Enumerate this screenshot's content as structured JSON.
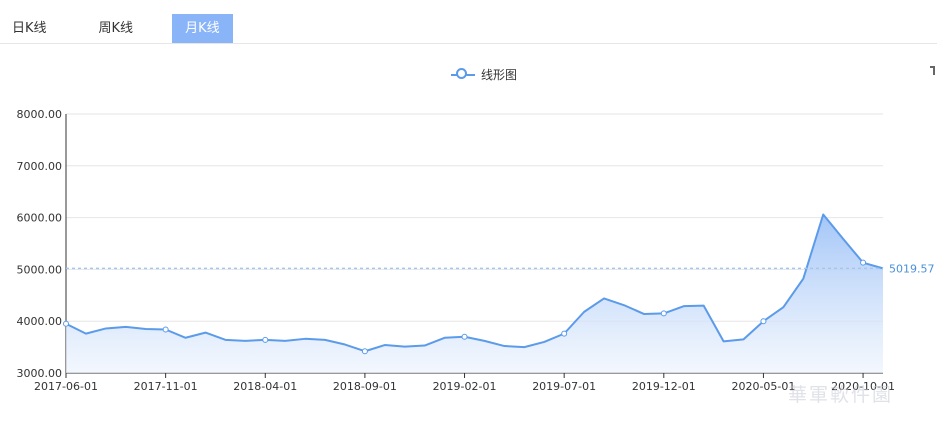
{
  "tabs": [
    {
      "label": "日K线",
      "active": false
    },
    {
      "label": "周K线",
      "active": false
    },
    {
      "label": "月K线",
      "active": true
    }
  ],
  "colors": {
    "accent_tab": "#8ab4f8",
    "line": "#5b9bea",
    "area_top": "#9fc3f7",
    "area_bottom": "#eef4fd",
    "markline": "#a9c6ea",
    "markline_label": "#4a90d9",
    "grid": "#e6e6e6",
    "axis_text": "#333333"
  },
  "watermark": "華軍軟件園",
  "chart_data": {
    "type": "area",
    "legend": [
      "线形图"
    ],
    "legend_position": "top-center",
    "grid": true,
    "ylim": [
      3000,
      8000
    ],
    "y_ticks": [
      "8000.00",
      "7000.00",
      "6000.00",
      "5000.00",
      "4000.00",
      "3000.00"
    ],
    "y_tick_values": [
      8000,
      7000,
      6000,
      5000,
      4000,
      3000
    ],
    "x_ticks": [
      "2017-06-01",
      "2017-11-01",
      "2018-04-01",
      "2018-09-01",
      "2019-02-01",
      "2019-07-01",
      "2019-12-01",
      "2020-05-01",
      "2020-10-01"
    ],
    "x": [
      "2017-06-01",
      "2017-07-01",
      "2017-08-01",
      "2017-09-01",
      "2017-10-01",
      "2017-11-01",
      "2017-12-01",
      "2018-01-01",
      "2018-02-01",
      "2018-03-01",
      "2018-04-01",
      "2018-05-01",
      "2018-06-01",
      "2018-07-01",
      "2018-08-01",
      "2018-09-01",
      "2018-10-01",
      "2018-11-01",
      "2018-12-01",
      "2019-01-01",
      "2019-02-01",
      "2019-03-01",
      "2019-04-01",
      "2019-05-01",
      "2019-06-01",
      "2019-07-01",
      "2019-08-01",
      "2019-09-01",
      "2019-10-01",
      "2019-11-01",
      "2019-12-01",
      "2020-01-01",
      "2020-02-01",
      "2020-03-01",
      "2020-04-01",
      "2020-05-01",
      "2020-06-01",
      "2020-07-01",
      "2020-08-01",
      "2020-09-01",
      "2020-10-01",
      "2020-11-01"
    ],
    "series": [
      {
        "name": "线形图",
        "values": [
          3950,
          3760,
          3860,
          3890,
          3850,
          3840,
          3680,
          3780,
          3640,
          3620,
          3640,
          3620,
          3660,
          3640,
          3550,
          3420,
          3540,
          3510,
          3530,
          3680,
          3700,
          3620,
          3520,
          3500,
          3600,
          3760,
          4180,
          4440,
          4310,
          4140,
          4150,
          4290,
          4300,
          3610,
          3650,
          4000,
          4270,
          4820,
          6060,
          5590,
          5130,
          5020
        ]
      }
    ],
    "mark_line": {
      "type": "horizontal",
      "value": 5019.57,
      "label": "5019.57"
    }
  }
}
